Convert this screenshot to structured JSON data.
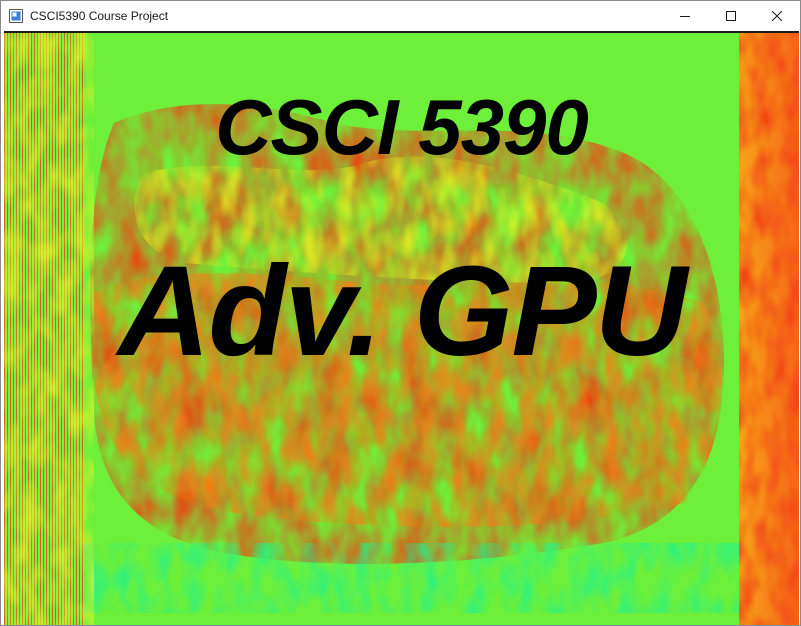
{
  "window": {
    "title": "CSCI5390 Course Project",
    "controls": {
      "minimize_icon": "minimize-icon",
      "maximize_icon": "maximize-icon",
      "close_icon": "close-icon"
    }
  },
  "canvas": {
    "line1": "CSCI 5390",
    "line2": "Adv. GPU",
    "colors": {
      "background_green": "#6ef03a",
      "hot_red": "#f23a12",
      "orange": "#fb7a10",
      "yellow": "#e8f020",
      "cyan_green": "#22f08a",
      "text": "#000000"
    }
  }
}
